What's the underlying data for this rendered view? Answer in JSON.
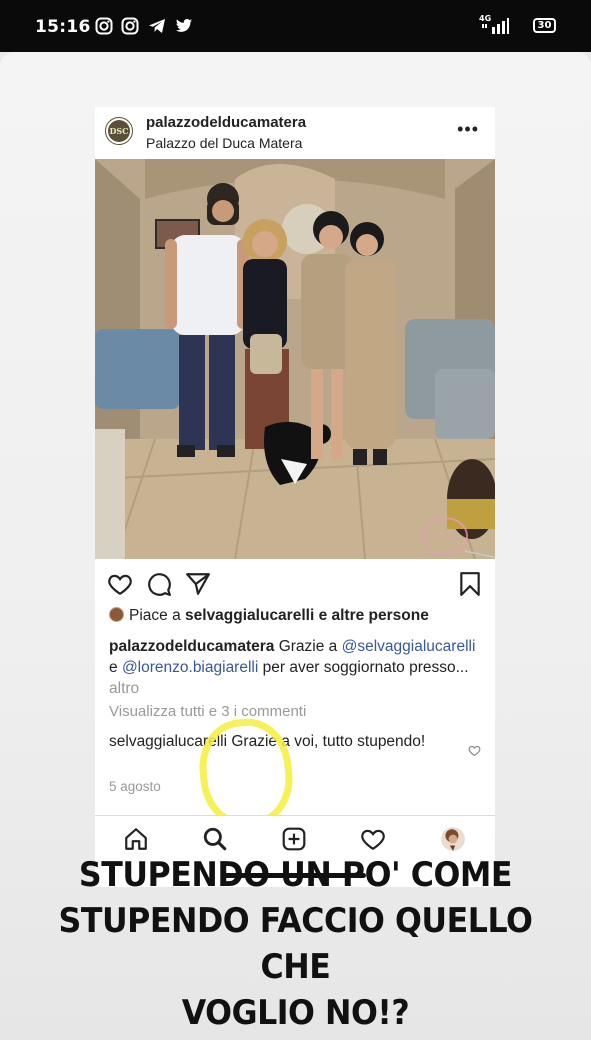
{
  "status_bar": {
    "time": "15:16",
    "network": "4G",
    "battery": "30",
    "icons": [
      "instagram-icon",
      "instagram-icon",
      "telegram-icon",
      "twitter-icon"
    ]
  },
  "post": {
    "username": "palazzodelducamatera",
    "location": "Palazzo del Duca Matera",
    "avatar_text": "DSC",
    "more": "•••",
    "likes": {
      "prefix": "Piace a",
      "user": "selvaggialucarelli",
      "suffix": "e altre persone"
    },
    "caption": {
      "user": "palazzodelducamatera",
      "text_1": "Grazie a",
      "mention_1": "@selvaggialucarelli",
      "and": "e",
      "mention_2": "@lorenzo.biagiarelli",
      "text_2": "per aver soggiornato presso...",
      "more": "altro"
    },
    "view_all": "Visualizza tutti e 3 i commenti",
    "reply": {
      "user": "selvaggialucarelli",
      "text": "Grazie a voi, tutto stupendo!"
    },
    "date": "5 agosto"
  },
  "story_caption": {
    "line1": "STUPENDO UN PO' COME",
    "line2": "STUPENDO FACCIO QUELLO CHE",
    "line3": "VOGLIO NO!?"
  },
  "colors": {
    "highlight": "#f3ee3a",
    "mention": "#385898"
  }
}
